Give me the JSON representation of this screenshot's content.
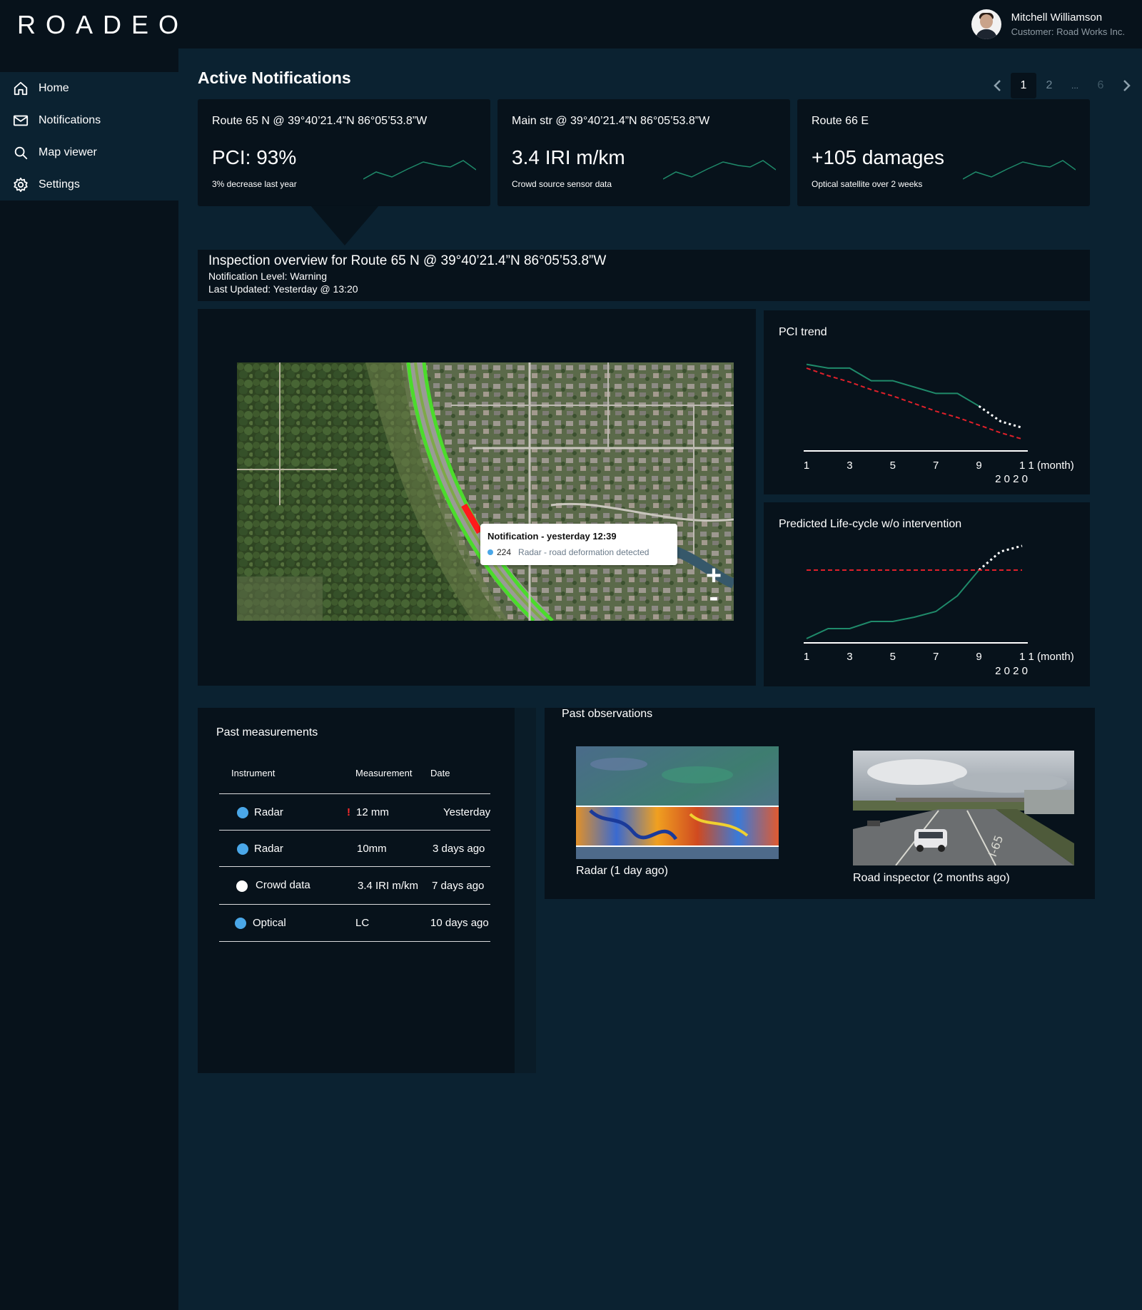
{
  "app": {
    "logo": "ROADEO"
  },
  "user": {
    "name": "Mitchell Williamson",
    "subtitle": "Customer: Road Works Inc."
  },
  "sidebar": {
    "items": [
      {
        "label": "Home",
        "icon": "home-icon"
      },
      {
        "label": "Notifications",
        "icon": "mail-icon"
      },
      {
        "label": "Map viewer",
        "icon": "search-icon"
      },
      {
        "label": "Settings",
        "icon": "gear-icon"
      }
    ]
  },
  "notifications": {
    "title": "Active Notifications",
    "pager": {
      "pages": [
        "1",
        "2",
        "...",
        "6"
      ],
      "current": "1"
    },
    "cards": [
      {
        "title": "Route 65 N @ 39°40’21.4”N 86°05’53.8”W",
        "value": "PCI: 93%",
        "subtitle": "3% decrease last year"
      },
      {
        "title": "Main str @ 39°40’21.4”N 86°05’53.8”W",
        "value": "3.4 IRI m/km",
        "subtitle": "Crowd source sensor data"
      },
      {
        "title": "Route 66 E",
        "value": "+105 damages",
        "subtitle": "Optical satellite over 2 weeks"
      }
    ]
  },
  "overview": {
    "title": "Inspection overview for Route 65 N @ 39°40’21.4”N 86°05’53.8”W",
    "level": "Notification Level: Warning",
    "updated": "Last Updated: Yesterday @ 13:20"
  },
  "map": {
    "tooltip": {
      "title": "Notification - yesterday 12:39",
      "count": "224",
      "text": "Radar - road deformation detected"
    },
    "zoom_in": "+",
    "zoom_out": "-"
  },
  "charts": {
    "x_tick_labels": [
      "1",
      "3",
      "5",
      "7",
      "9",
      "1 1 (month)"
    ],
    "x_year": "2 0 2 0",
    "pci": {
      "title": "PCI trend"
    },
    "lifecycle": {
      "title": "Predicted Life-cycle w/o intervention"
    }
  },
  "chart_data": [
    {
      "type": "line",
      "title": "PCI trend",
      "x": [
        1,
        2,
        3,
        4,
        5,
        6,
        7,
        8,
        9,
        10,
        11
      ],
      "x_ticks": [
        1,
        3,
        5,
        7,
        9,
        11
      ],
      "xlabel": "(month) 2020",
      "series": [
        {
          "values": [
            100,
            97,
            97,
            87,
            87,
            82,
            77,
            77,
            67,
            null,
            null
          ],
          "color": "#1f8a6a"
        },
        {
          "values": [
            null,
            null,
            null,
            null,
            null,
            null,
            null,
            null,
            67,
            55,
            50
          ],
          "color": "#ffffff",
          "style": "dotted"
        },
        {
          "values": [
            97,
            91,
            86,
            80,
            75,
            69,
            63,
            58,
            52,
            46,
            41
          ],
          "color": "#e0202a",
          "style": "dashed"
        }
      ]
    },
    {
      "type": "line",
      "title": "Predicted Life-cycle w/o intervention",
      "x": [
        1,
        2,
        3,
        4,
        5,
        6,
        7,
        8,
        9,
        10,
        11
      ],
      "x_ticks": [
        1,
        3,
        5,
        7,
        9,
        11
      ],
      "xlabel": "(month) 2020",
      "series": [
        {
          "values": [
            0,
            14,
            14,
            24,
            24,
            30,
            38,
            60,
            96,
            null,
            null
          ],
          "color": "#1f8a6a"
        },
        {
          "values": [
            null,
            null,
            null,
            null,
            null,
            null,
            null,
            null,
            96,
            122,
            130
          ],
          "color": "#ffffff",
          "style": "dotted"
        },
        {
          "values": [
            96,
            96,
            96,
            96,
            96,
            96,
            96,
            96,
            96,
            96,
            96
          ],
          "color": "#e0202a",
          "style": "dashed"
        }
      ]
    }
  ],
  "measurements": {
    "title": "Past measurements",
    "headers": {
      "instrument": "Instrument",
      "measurement": "Measurement",
      "date": "Date"
    },
    "rows": [
      {
        "instrument": "Radar",
        "measurement": "12 mm",
        "date": "Yesterday",
        "warning": "!",
        "dot_color": "#4aa7e8"
      },
      {
        "instrument": "Radar",
        "measurement": "10mm",
        "date": "3 days ago",
        "dot_color": "#4aa7e8"
      },
      {
        "instrument": "Crowd data",
        "measurement": "3.4 IRI m/km",
        "date": "7 days ago",
        "dot_color": "#ffffff"
      },
      {
        "instrument": "Optical",
        "measurement": "LC",
        "date": "10 days ago",
        "dot_color": "#4aa7e8"
      }
    ]
  },
  "observations": {
    "title": "Past observations",
    "items": [
      {
        "caption": "Radar (1 day ago)"
      },
      {
        "caption": "Road inspector (2 months ago)",
        "sign": "I-65"
      }
    ]
  },
  "colors": {
    "bg": "#0b2231",
    "panel": "#07121b",
    "accent_green": "#1f8a6a",
    "alert_red": "#e0202a",
    "dot_blue": "#4aa7e8"
  }
}
